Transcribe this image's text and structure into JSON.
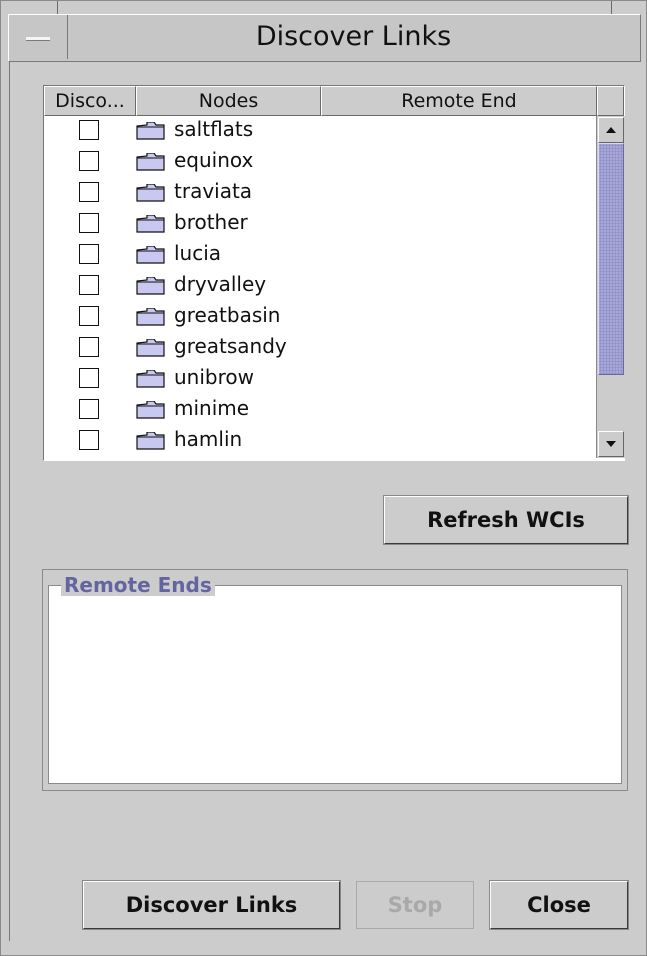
{
  "window": {
    "title": "Discover Links"
  },
  "table": {
    "columns": [
      "Disco...",
      "Nodes",
      "Remote End"
    ],
    "rows": [
      {
        "checked": false,
        "node": "saltflats",
        "remote_end": ""
      },
      {
        "checked": false,
        "node": "equinox",
        "remote_end": ""
      },
      {
        "checked": false,
        "node": "traviata",
        "remote_end": ""
      },
      {
        "checked": false,
        "node": "brother",
        "remote_end": ""
      },
      {
        "checked": false,
        "node": "lucia",
        "remote_end": ""
      },
      {
        "checked": false,
        "node": "dryvalley",
        "remote_end": ""
      },
      {
        "checked": false,
        "node": "greatbasin",
        "remote_end": ""
      },
      {
        "checked": false,
        "node": "greatsandy",
        "remote_end": ""
      },
      {
        "checked": false,
        "node": "unibrow",
        "remote_end": ""
      },
      {
        "checked": false,
        "node": "minime",
        "remote_end": ""
      },
      {
        "checked": false,
        "node": "hamlin",
        "remote_end": ""
      }
    ],
    "row_icon": "folder-icon"
  },
  "buttons": {
    "refresh": "Refresh WCIs",
    "discover": "Discover Links",
    "stop": "Stop",
    "close": "Close"
  },
  "remote_ends": {
    "label": "Remote Ends"
  },
  "colors": {
    "background": "#cccccc",
    "accent": "#6464a0",
    "folder_fill": "#c8c8f0",
    "scroll_thumb": "#a6a6d8"
  }
}
